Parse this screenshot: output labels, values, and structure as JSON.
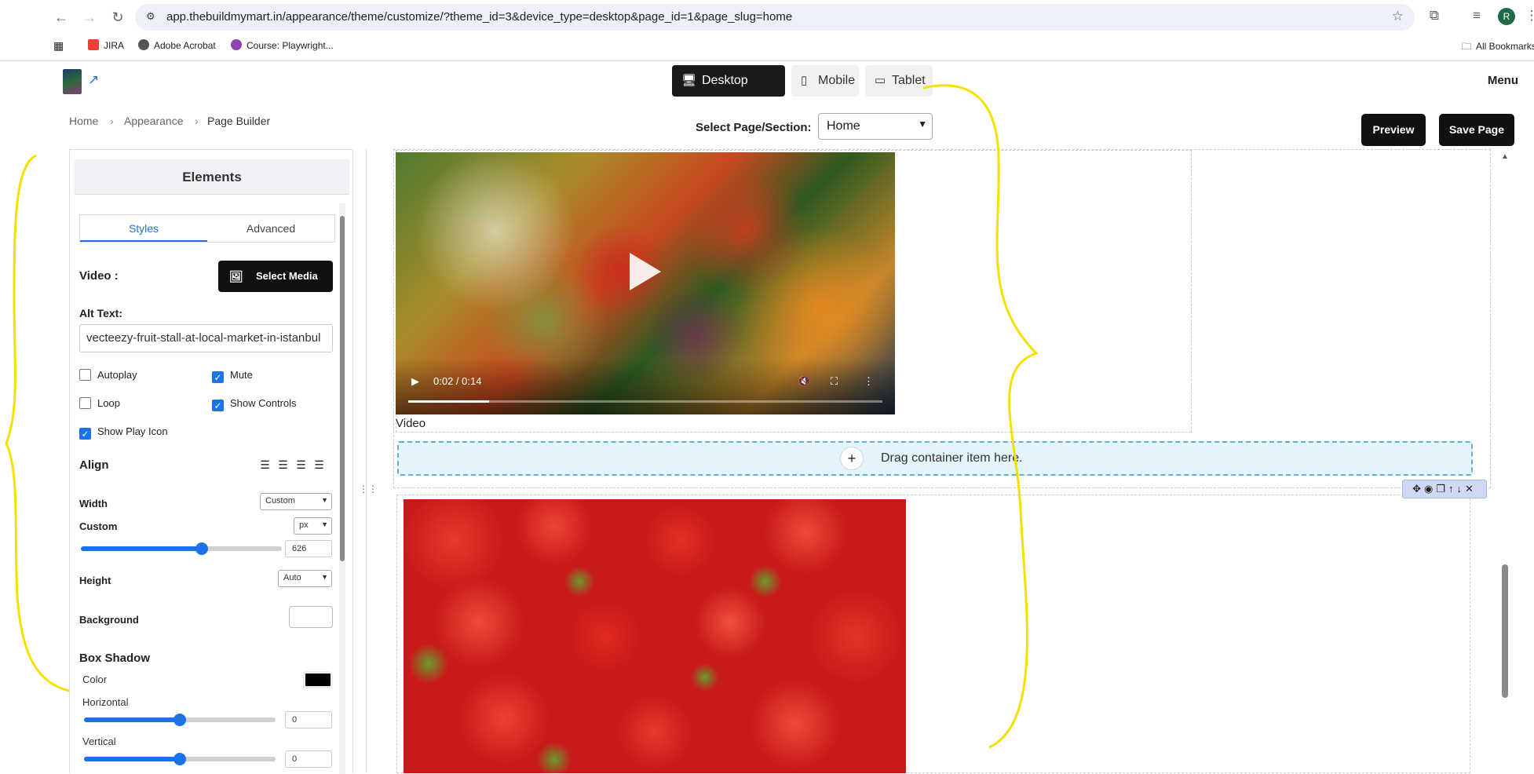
{
  "browser": {
    "url": "app.thebuildmymart.in/appearance/theme/customize/?theme_id=3&device_type=desktop&page_id=1&page_slug=home",
    "bookmarks": [
      "JIRA",
      "Adobe Acrobat",
      "Course: Playwright..."
    ],
    "all_bookmarks": "All Bookmarks",
    "profile_initial": "R"
  },
  "header": {
    "devices": [
      "Desktop",
      "Mobile",
      "Tablet"
    ],
    "active_device": "Desktop",
    "menu_label": "Menu"
  },
  "subheader": {
    "breadcrumb": [
      "Home",
      "Appearance",
      "Page Builder"
    ],
    "select_label": "Select Page/Section:",
    "selected_page": "Home",
    "preview_label": "Preview",
    "save_label": "Save Page"
  },
  "panel": {
    "title": "Elements",
    "tabs": [
      "Styles",
      "Advanced"
    ],
    "active_tab": "Styles",
    "video_label": "Video :",
    "select_media_label": "Select Media",
    "alt_text_label": "Alt Text:",
    "alt_text_value": "vecteezy-fruit-stall-at-local-market-in-istanbul",
    "options": {
      "autoplay": {
        "label": "Autoplay",
        "checked": false
      },
      "mute": {
        "label": "Mute",
        "checked": true
      },
      "loop": {
        "label": "Loop",
        "checked": false
      },
      "show_controls": {
        "label": "Show Controls",
        "checked": true
      },
      "show_play_icon": {
        "label": "Show Play Icon",
        "checked": true
      }
    },
    "align_label": "Align",
    "width_label": "Width",
    "width_mode": "Custom",
    "custom_label": "Custom",
    "custom_unit": "px",
    "custom_value": "626",
    "custom_fill": 0.6,
    "height_label": "Height",
    "height_mode": "Auto",
    "background_label": "Background",
    "box_shadow_label": "Box Shadow",
    "color_label": "Color",
    "shadow_color": "#000000",
    "horizontal_label": "Horizontal",
    "horizontal_value": "0",
    "horizontal_fill": 0.5,
    "vertical_label": "Vertical",
    "vertical_value": "0",
    "vertical_fill": 0.5
  },
  "canvas": {
    "video_time": "0:02 / 0:14",
    "video_progress": 0.17,
    "video_caption": "Video",
    "dropzone_text": "Drag container item here."
  }
}
